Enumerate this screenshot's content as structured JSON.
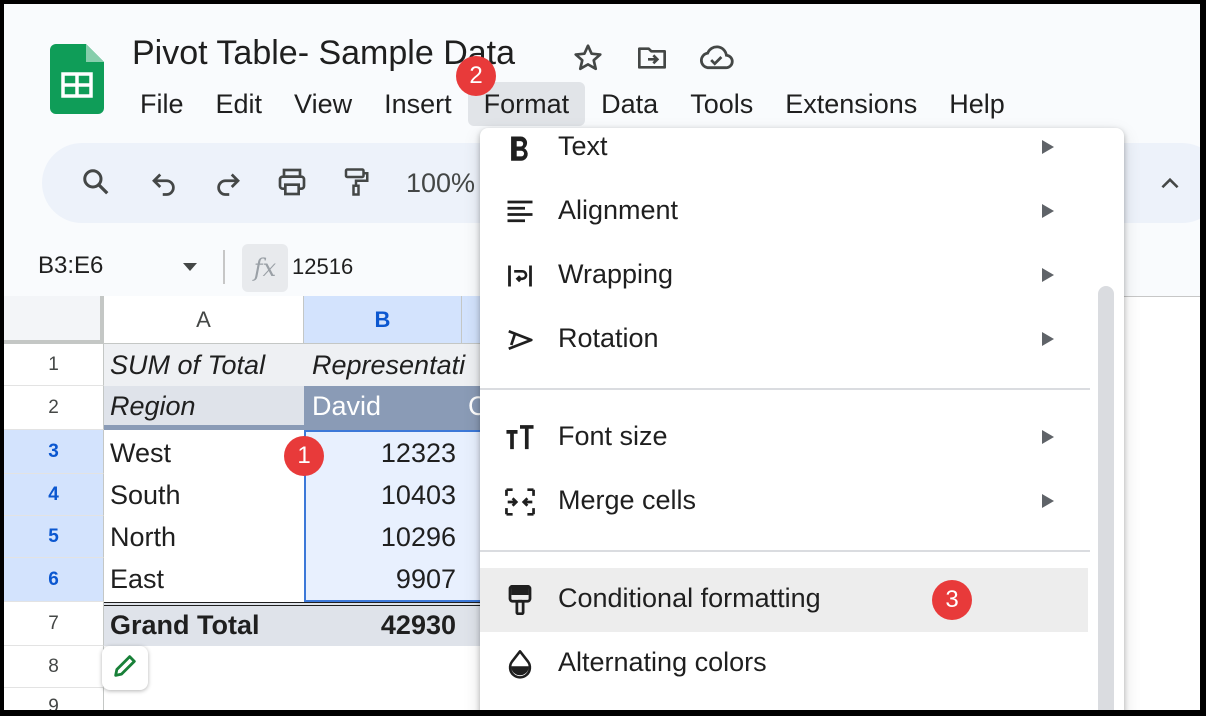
{
  "document": {
    "title": "Pivot Table- Sample Data"
  },
  "menubar": [
    "File",
    "Edit",
    "View",
    "Insert",
    "Format",
    "Data",
    "Tools",
    "Extensions",
    "Help"
  ],
  "toolbar": {
    "zoom": "100%"
  },
  "formula_bar": {
    "name_box": "B3:E6",
    "fx_label": "fx",
    "formula": "12516"
  },
  "grid": {
    "columns": [
      "A",
      "B"
    ],
    "rows": [
      "1",
      "2",
      "3",
      "4",
      "5",
      "6",
      "7",
      "8",
      "9"
    ],
    "pivot": {
      "a1": "SUM of Total",
      "b1": "Representati",
      "a2": "Region",
      "b2": "David",
      "c2": "C",
      "regions": [
        "West",
        "South",
        "North",
        "East"
      ],
      "values": [
        "12323",
        "10403",
        "10296",
        "9907"
      ],
      "grand_total_label": "Grand Total",
      "grand_total_value": "42930"
    }
  },
  "format_menu": {
    "items": [
      {
        "label": "Text",
        "icon": "bold-icon",
        "submenu": true
      },
      {
        "label": "Alignment",
        "icon": "align-left-icon",
        "submenu": true
      },
      {
        "label": "Wrapping",
        "icon": "text-wrap-icon",
        "submenu": true
      },
      {
        "label": "Rotation",
        "icon": "text-rotation-icon",
        "submenu": true
      },
      {
        "label": "Font size",
        "icon": "font-size-icon",
        "submenu": true
      },
      {
        "label": "Merge cells",
        "icon": "merge-cells-icon",
        "submenu": true
      },
      {
        "label": "Conditional formatting",
        "icon": "paint-roller-icon",
        "submenu": false,
        "highlighted": true
      },
      {
        "label": "Alternating colors",
        "icon": "ink-drop-icon",
        "submenu": false
      }
    ]
  },
  "step_badges": [
    "1",
    "2",
    "3"
  ],
  "colors": {
    "sheets_green": "#0f9d58",
    "selection_blue": "#d3e3fd",
    "pivot_header": "#8a9bb6",
    "badge_red": "#e83a3a"
  }
}
